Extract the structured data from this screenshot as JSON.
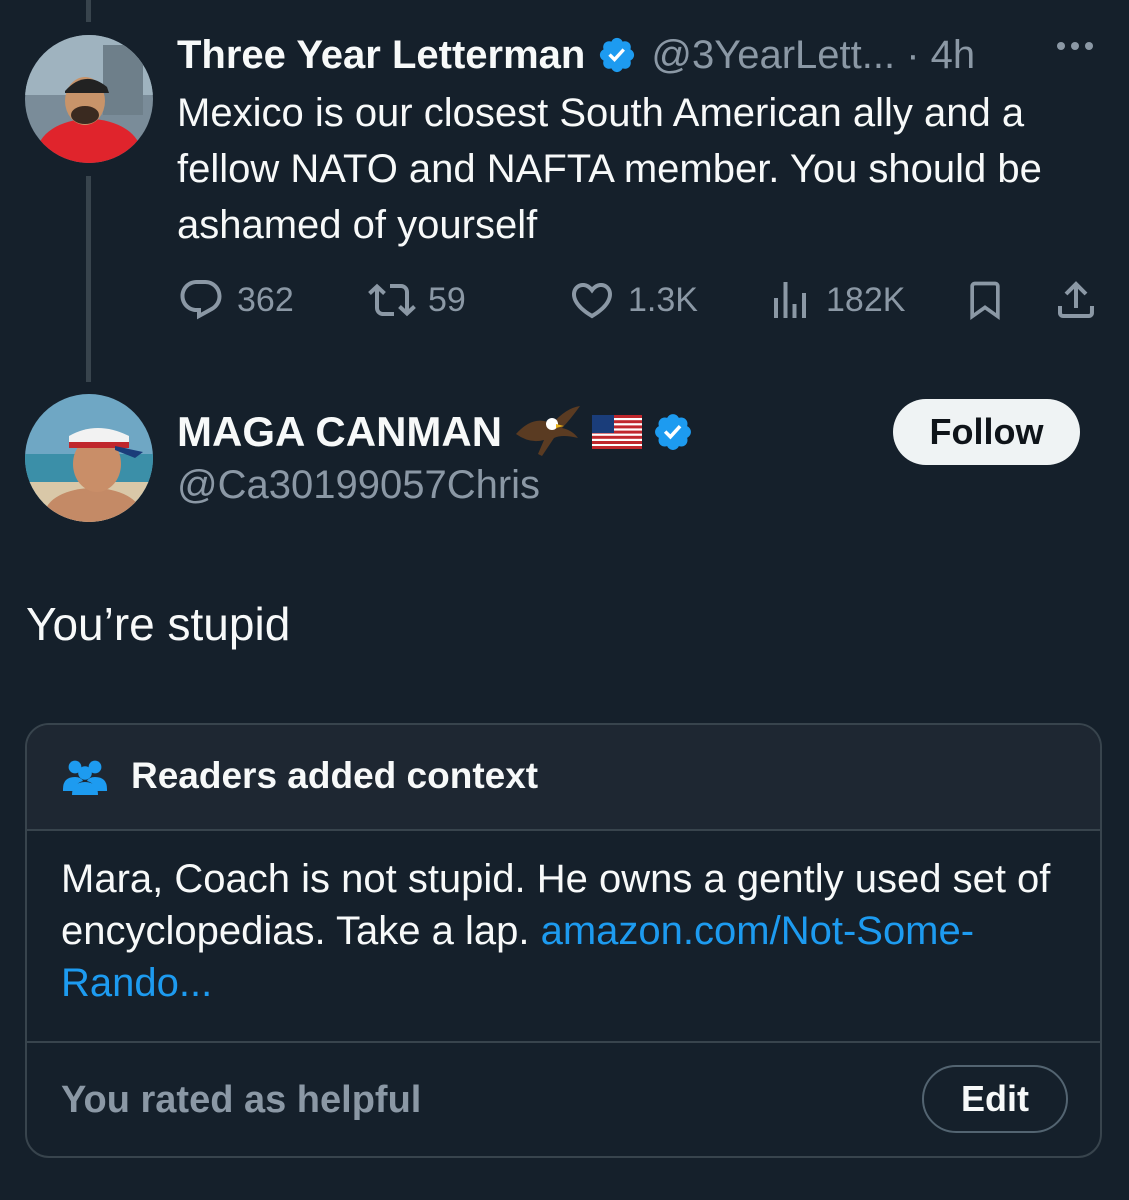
{
  "colors": {
    "background": "#15202b",
    "text_primary": "#f7f9f9",
    "text_secondary": "#8b98a5",
    "accent": "#1d9bf0",
    "border": "#38444d"
  },
  "parent_tweet": {
    "display_name": "Three Year Letterman",
    "verified_icon": "verified-badge-icon",
    "handle_time": "@3YearLett... · 4h",
    "more_icon": "more-horizontal-icon",
    "text": "Mexico is our closest South American ally and a fellow NATO and NAFTA member. You should be ashamed of yourself",
    "actions": {
      "replies": "362",
      "retweets": "59",
      "likes": "1.3K",
      "views": "182K"
    }
  },
  "reply_tweet": {
    "display_name": "MAGA CANMAN",
    "emoji_icons": [
      "eagle-emoji-icon",
      "us-flag-emoji-icon"
    ],
    "handle": "@Ca30199057Chris",
    "follow_label": "Follow",
    "text": "You’re stupid"
  },
  "community_note": {
    "icon": "people-icon",
    "title": "Readers added context",
    "body": "Mara, Coach is not stupid. He owns a gently used set of encyclopedias. Take a lap.",
    "link_text": "amazon.com/Not-Some-Rando...",
    "rating_text": "You rated as helpful",
    "edit_label": "Edit"
  }
}
